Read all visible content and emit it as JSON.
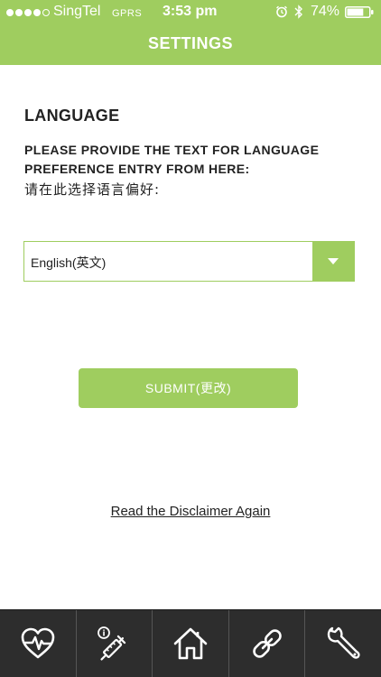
{
  "status_bar": {
    "carrier": "SingTel",
    "network": "GPRS",
    "time": "3:53 pm",
    "battery": "74%",
    "battery_level": 0.74,
    "signal_strength": 4,
    "signal_max": 5
  },
  "nav": {
    "title": "SETTINGS"
  },
  "language_section": {
    "heading": "LANGUAGE",
    "instruction_line1": "PLEASE PROVIDE THE TEXT FOR LANGUAGE",
    "instruction_line2": "PREFERENCE ENTRY FROM HERE:",
    "instruction_cn": "请在此选择语言偏好:",
    "selected_language": "English(英文)"
  },
  "submit_label": "SUBMIT(更改)",
  "disclaimer_link": "Read the Disclaimer Again",
  "tabs": [
    {
      "icon": "heart-pulse-icon"
    },
    {
      "icon": "syringe-info-icon"
    },
    {
      "icon": "home-icon"
    },
    {
      "icon": "link-icon"
    },
    {
      "icon": "wrench-icon"
    }
  ],
  "colors": {
    "accent": "#9fcd5f",
    "tab_bar": "#2d2d2d",
    "text": "#222222"
  }
}
